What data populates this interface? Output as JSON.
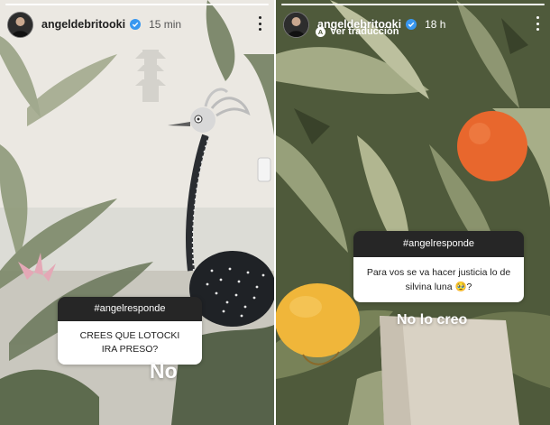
{
  "left_story": {
    "username": "angeldebritooki",
    "time": "15 min",
    "question_tag": "#angelresponde",
    "question_line1": "CREES QUE LOTOCKI",
    "question_line2": "IRA PRESO?",
    "answer": "No"
  },
  "right_story": {
    "username": "angeldebritooki",
    "time": "18 h",
    "translate_label": "Ver traducción",
    "question_tag": "#angelresponde",
    "question_line1": "Para vos se va hacer justicia lo de",
    "question_line2": "silvina luna 🥹?",
    "answer": "No lo creo"
  },
  "colors": {
    "question_header": "#262626",
    "verified": "#3897f0",
    "orange": "#e8672d",
    "yellow_fruit": "#f0b63a"
  },
  "icons": [
    "verified-badge-icon",
    "more-options-icon",
    "translate-icon",
    "avatar"
  ]
}
